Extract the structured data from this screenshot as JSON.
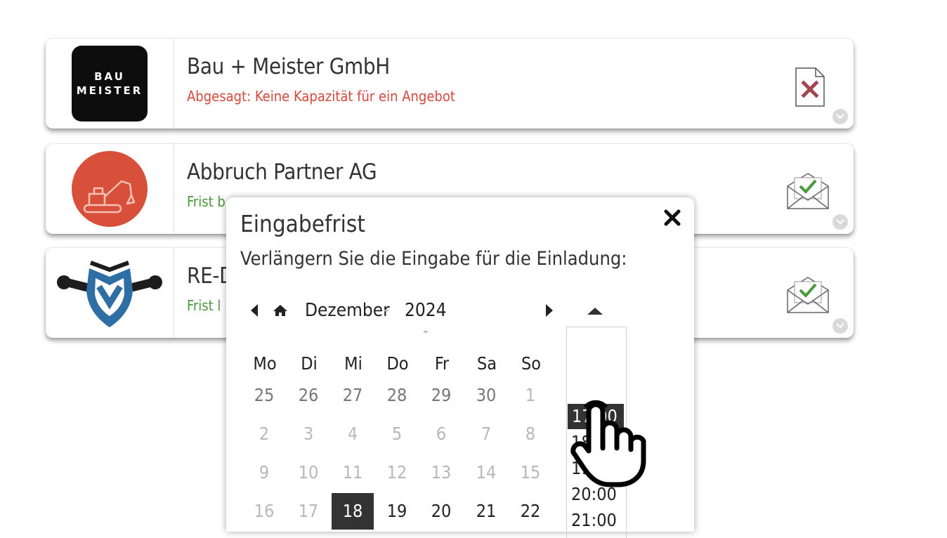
{
  "companies": [
    {
      "name": "Bau + Meister GmbH",
      "status": "Abgesagt: Keine Kapazität für ein Angebot",
      "status_color": "#d8493d",
      "logo_text_1": "BAU",
      "logo_text_2": "MEISTER",
      "doc_icon": "declined-doc-icon"
    },
    {
      "name": "Abbruch Partner AG",
      "status": "Frist b",
      "status_color": "#4a9a3c",
      "doc_icon": "accepted-mail-icon"
    },
    {
      "name": "RE-D",
      "status": "Frist l",
      "status_color": "#4a9a3c",
      "doc_icon": "accepted-mail-icon"
    }
  ],
  "modal": {
    "title": "Eingabefrist",
    "subtitle": "Verlängern Sie die Eingabe für die Einladung:",
    "month": "Dezember",
    "year": "2024"
  },
  "calendar": {
    "weekdays": [
      "Mo",
      "Di",
      "Mi",
      "Do",
      "Fr",
      "Sa",
      "So"
    ],
    "weeks": [
      [
        "25",
        "26",
        "27",
        "28",
        "29",
        "30",
        "1"
      ],
      [
        "2",
        "3",
        "4",
        "5",
        "6",
        "7",
        "8"
      ],
      [
        "9",
        "10",
        "11",
        "12",
        "13",
        "14",
        "15"
      ],
      [
        "16",
        "17",
        "18",
        "19",
        "20",
        "21",
        "22"
      ]
    ],
    "selected_day": "18"
  },
  "times": {
    "items": [
      "17:00",
      "18:00",
      "19:00",
      "20:00",
      "21:00"
    ],
    "selected": "17:00"
  },
  "colors": {
    "accent_dark": "#333333",
    "logo_orange": "#d9503a",
    "logo_blue": "#2f6ea5"
  }
}
